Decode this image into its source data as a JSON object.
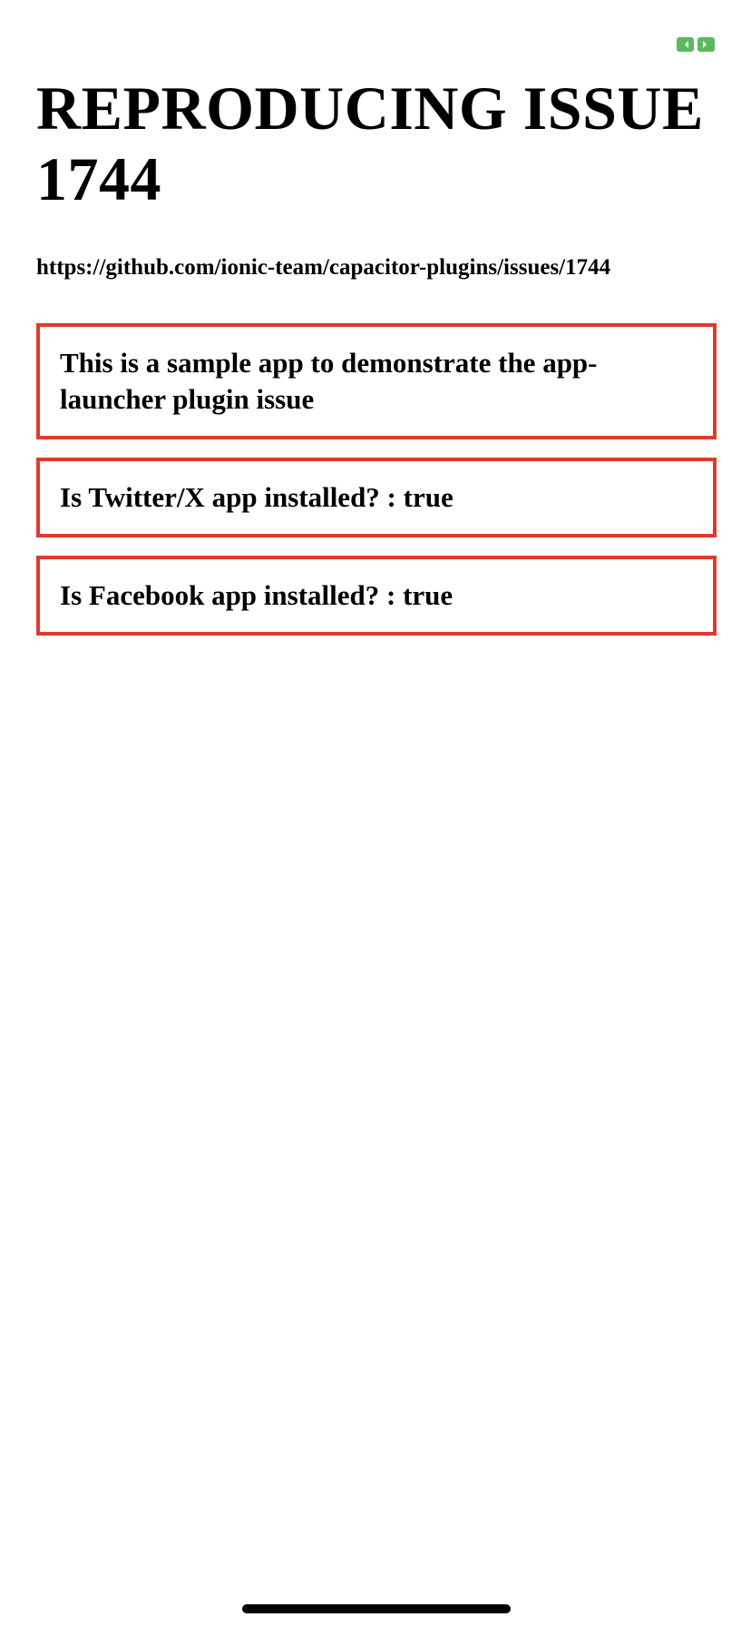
{
  "status": {
    "icon": "green-indicator-icon",
    "color": "#5cb85c"
  },
  "header": {
    "title": "REPRODUCING ISSUE 1744",
    "link": "https://github.com/ionic-team/capacitor-plugins/issues/1744"
  },
  "cards": {
    "intro": "This is a sample app to demonstrate the app-launcher plugin issue",
    "twitter": "Is Twitter/X app installed? : true",
    "facebook": "Is Facebook app installed? : true"
  },
  "colors": {
    "card_border": "#e03a2f",
    "text": "#000000",
    "background": "#ffffff"
  }
}
